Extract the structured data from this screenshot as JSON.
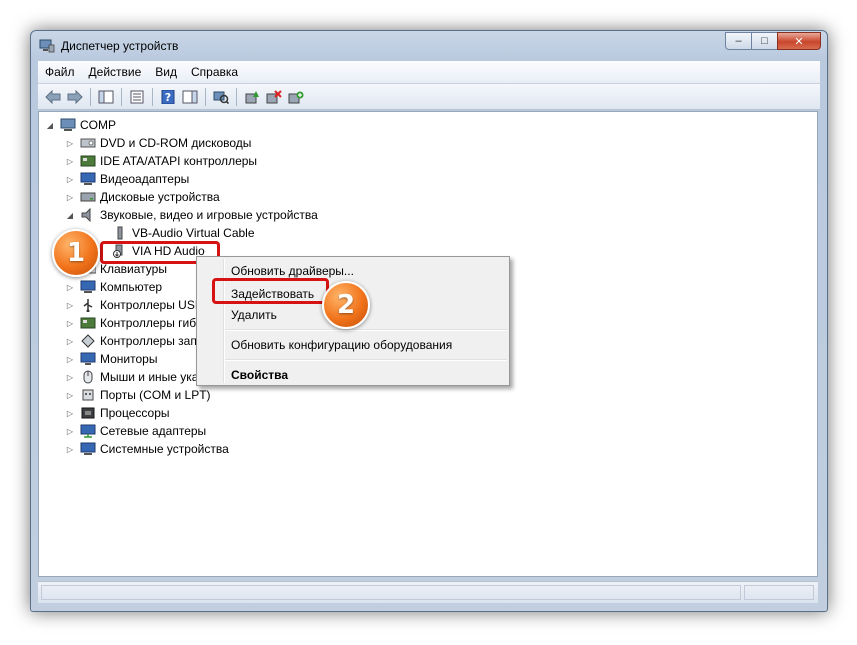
{
  "window": {
    "title": "Диспетчер устройств",
    "buttons": {
      "minimize": "–",
      "maximize": "□",
      "close": "✕"
    }
  },
  "menu": [
    "Файл",
    "Действие",
    "Вид",
    "Справка"
  ],
  "toolbar_icons": [
    "back-arrow-icon",
    "forward-arrow-icon",
    "show-hide-tree-icon",
    "properties-icon",
    "help-icon",
    "action-pane-icon",
    "scan-hardware-icon",
    "update-driver-icon",
    "uninstall-icon",
    "enable-device-icon"
  ],
  "tree": {
    "root": "COMP",
    "items": [
      {
        "label": "DVD и CD-ROM дисководы",
        "icon": "dvd-drive-icon"
      },
      {
        "label": "IDE ATA/ATAPI контроллеры",
        "icon": "ide-controller-icon"
      },
      {
        "label": "Видеоадаптеры",
        "icon": "display-adapter-icon"
      },
      {
        "label": "Дисковые устройства",
        "icon": "disk-drive-icon"
      },
      {
        "label": "Звуковые, видео и игровые устройства",
        "icon": "sound-icon"
      },
      {
        "label": "VB-Audio Virtual Cable",
        "icon": "speaker-icon"
      },
      {
        "label": "VIA HD Audio",
        "icon": "disabled-speaker-icon"
      },
      {
        "label": "Клавиатуры",
        "icon": "keyboard-icon"
      },
      {
        "label": "Компьютер",
        "icon": "computer-icon"
      },
      {
        "label": "Контроллеры USB",
        "icon": "usb-icon"
      },
      {
        "label": "Контроллеры гибких дисков",
        "icon": "floppy-controller-icon"
      },
      {
        "label": "Контроллеры запоминающих устройств",
        "icon": "storage-controller-icon"
      },
      {
        "label": "Мониторы",
        "icon": "monitor-icon"
      },
      {
        "label": "Мыши и иные указывающие устройства",
        "icon": "mouse-icon"
      },
      {
        "label": "Порты (COM и LPT)",
        "icon": "port-icon"
      },
      {
        "label": "Процессоры",
        "icon": "processor-icon"
      },
      {
        "label": "Сетевые адаптеры",
        "icon": "network-adapter-icon"
      },
      {
        "label": "Системные устройства",
        "icon": "system-device-icon"
      }
    ]
  },
  "context_menu": {
    "update_drivers": "Обновить драйверы...",
    "enable": "Задействовать",
    "delete": "Удалить",
    "scan": "Обновить конфигурацию оборудования",
    "properties": "Свойства"
  },
  "badges": {
    "one": "1",
    "two": "2"
  },
  "colors": {
    "highlight_border": "#d61212",
    "badge_orange": "#f1731b"
  }
}
